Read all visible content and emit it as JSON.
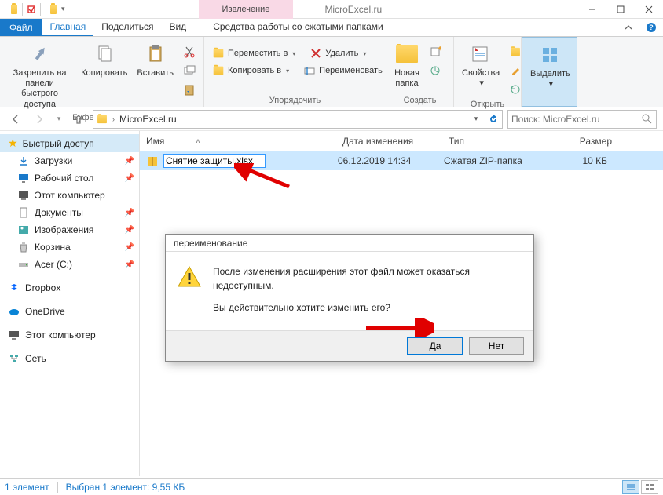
{
  "titlebar": {
    "context_tab": "Извлечение",
    "app_title": "MicroExcel.ru"
  },
  "menu": {
    "file": "Файл",
    "tabs": [
      "Главная",
      "Поделиться",
      "Вид"
    ],
    "context_tab": "Средства работы со сжатыми папками",
    "chevron_tip": "^"
  },
  "ribbon": {
    "clipboard": {
      "pin": "Закрепить на панели\nбыстрого доступа",
      "copy": "Копировать",
      "paste": "Вставить",
      "label": "Буфер обмена"
    },
    "organize": {
      "move_to": "Переместить в",
      "copy_to": "Копировать в",
      "delete": "Удалить",
      "rename": "Переименовать",
      "label": "Упорядочить"
    },
    "new": {
      "new_folder": "Новая\nпапка",
      "label": "Создать"
    },
    "open": {
      "properties": "Свойства",
      "label": "Открыть"
    },
    "select": {
      "select": "Выделить",
      "label": ""
    }
  },
  "address": {
    "root": "",
    "folder": "MicroExcel.ru",
    "search_placeholder": "Поиск: MicroExcel.ru"
  },
  "columns": {
    "name": "Имя",
    "date": "Дата изменения",
    "type": "Тип",
    "size": "Размер"
  },
  "file": {
    "rename_value": "Снятие защиты.xlsx",
    "date": "06.12.2019 14:34",
    "type": "Сжатая ZIP-папка",
    "size": "10 КБ"
  },
  "sidebar": {
    "quick": "Быстрый доступ",
    "items": [
      "Загрузки",
      "Рабочий стол",
      "Этот компьютер",
      "Документы",
      "Изображения",
      "Корзина",
      "Acer (C:)"
    ],
    "dropbox": "Dropbox",
    "onedrive": "OneDrive",
    "this_pc": "Этот компьютер",
    "network": "Сеть"
  },
  "dialog": {
    "title": "переименование",
    "line1": "После изменения расширения этот файл может оказаться недоступным.",
    "line2": "Вы действительно хотите изменить его?",
    "yes": "Да",
    "no": "Нет"
  },
  "status": {
    "count": "1 элемент",
    "selected": "Выбран 1 элемент: 9,55 КБ"
  }
}
